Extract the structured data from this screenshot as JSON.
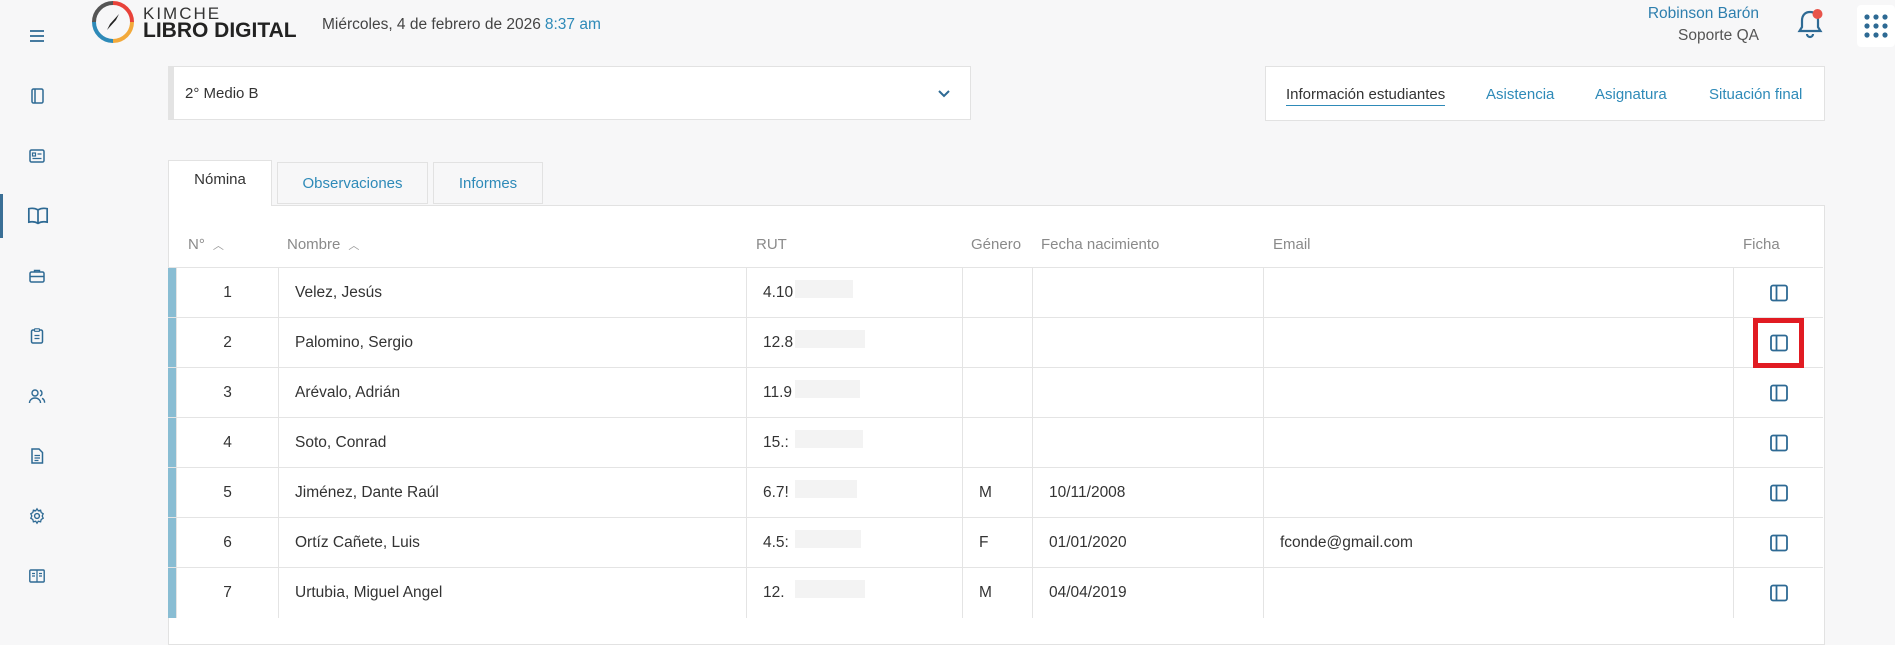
{
  "sidebar": {
    "icons": [
      "menu-icon",
      "notebook-icon",
      "id-card-icon",
      "book-icon",
      "briefcase-icon",
      "clipboard-icon",
      "users-icon",
      "document-icon",
      "gear-icon",
      "reading-book-icon"
    ],
    "active_index": 3
  },
  "header": {
    "brand_top": "KIMCHE",
    "brand_bottom": "LIBRO DIGITAL",
    "date": "Miércoles, 4 de febrero de 2026",
    "time": "8:37 am",
    "user_name": "Robinson Barón",
    "user_role": "Soporte QA"
  },
  "course_select": {
    "value": "2° Medio B"
  },
  "nav": {
    "links": [
      "Información estudiantes",
      "Asistencia",
      "Asignatura",
      "Situación final"
    ],
    "active": "Información estudiantes"
  },
  "tabs": [
    "Nómina",
    "Observaciones",
    "Informes"
  ],
  "table": {
    "headers": [
      "N°",
      "Nombre",
      "RUT",
      "Género",
      "Fecha nacimiento",
      "Email",
      "Ficha"
    ],
    "rows": [
      {
        "n": "1",
        "name": "Velez, Jesús",
        "rut": "4.10",
        "gender": "",
        "birth": "",
        "email": ""
      },
      {
        "n": "2",
        "name": "Palomino, Sergio",
        "rut": "12.8",
        "gender": "",
        "birth": "",
        "email": ""
      },
      {
        "n": "3",
        "name": "Arévalo, Adrián",
        "rut": "11.9",
        "gender": "",
        "birth": "",
        "email": ""
      },
      {
        "n": "4",
        "name": "Soto, Conrad",
        "rut": "15.:",
        "gender": "",
        "birth": "",
        "email": ""
      },
      {
        "n": "5",
        "name": "Jiménez, Dante Raúl",
        "rut": "6.7!",
        "gender": "M",
        "birth": "10/11/2008",
        "email": ""
      },
      {
        "n": "6",
        "name": "Ortíz Cañete, Luis",
        "rut": "4.5:",
        "gender": "F",
        "birth": "01/01/2020",
        "email": "fconde@gmail.com"
      },
      {
        "n": "7",
        "name": "Urtubia, Miguel Angel",
        "rut": "12.",
        "gender": "M",
        "birth": "04/04/2019",
        "email": ""
      }
    ]
  },
  "colors": {
    "accent": "#2e8ab8",
    "row_bar": "#89bdd3",
    "highlight": "#e11b22"
  }
}
